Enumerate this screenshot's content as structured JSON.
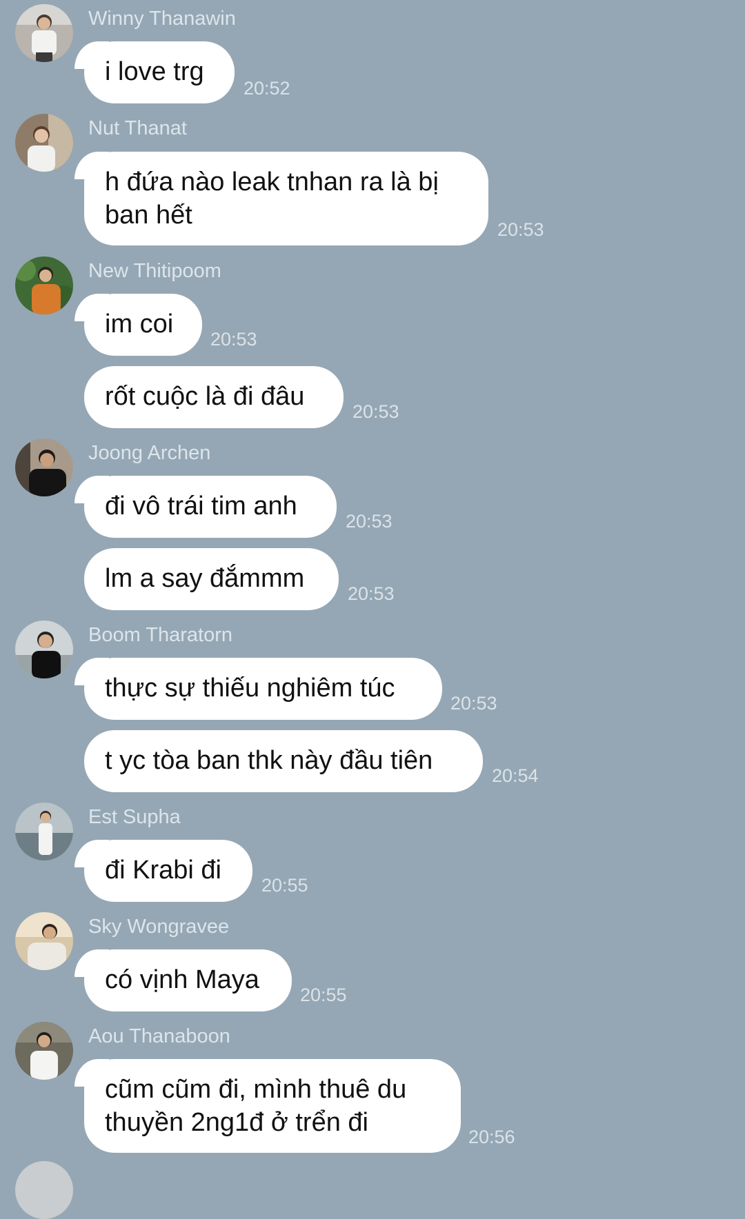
{
  "messages": [
    {
      "sender": "Winny Thanawin",
      "text": "i love trg",
      "time": "20:52"
    },
    {
      "sender": "Nut Thanat",
      "text": "h đứa nào leak tnhan ra là bị ban hết",
      "time": "20:53"
    },
    {
      "sender": "New Thitipoom",
      "text": "im coi",
      "time": "20:53"
    },
    {
      "sender": "",
      "text": "rốt cuộc là đi đâu",
      "time": "20:53"
    },
    {
      "sender": "Joong Archen",
      "text": "đi vô trái tim anh",
      "time": "20:53"
    },
    {
      "sender": "",
      "text": "lm a say đắmmm",
      "time": "20:53"
    },
    {
      "sender": "Boom Tharatorn",
      "text": "thực sự thiếu nghiêm túc",
      "time": "20:53"
    },
    {
      "sender": "",
      "text": "t yc tòa ban thk này đầu tiên",
      "time": "20:54"
    },
    {
      "sender": "Est Supha",
      "text": "đi Krabi đi",
      "time": "20:55"
    },
    {
      "sender": "Sky Wongravee",
      "text": "có vịnh Maya",
      "time": "20:55"
    },
    {
      "sender": "Aou Thanaboon",
      "text": "cũm cũm đi, mình thuê du thuyền 2ng1đ ở trển đi",
      "time": "20:56"
    }
  ],
  "colors": {
    "background": "#95a7b4",
    "bubble": "#ffffff",
    "sender_text": "#dde5eb",
    "time_text": "#dbe3e9",
    "message_text": "#111111"
  }
}
